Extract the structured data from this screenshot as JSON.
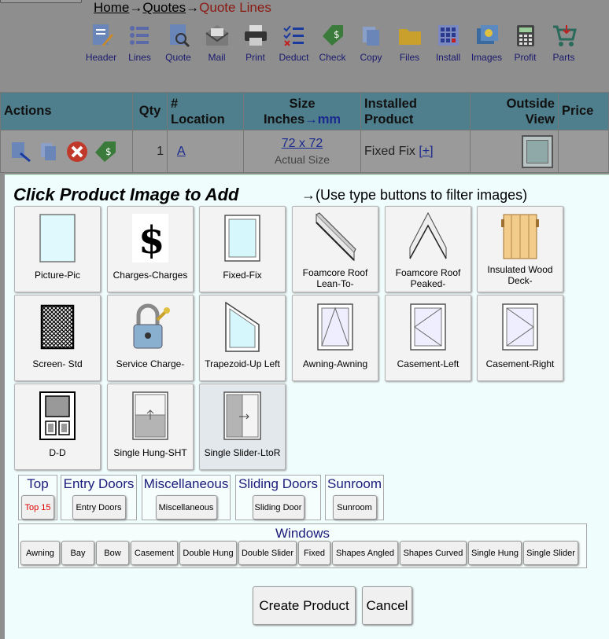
{
  "breadcrumb": {
    "home": "Home",
    "quotes": "Quotes",
    "current": "Quote Lines",
    "arrow": "→"
  },
  "toolbar": [
    {
      "label": "Header",
      "icon": "header-icon"
    },
    {
      "label": "Lines",
      "icon": "lines-icon"
    },
    {
      "label": "Quote",
      "icon": "quote-icon"
    },
    {
      "label": "Mail",
      "icon": "mail-icon"
    },
    {
      "label": "Print",
      "icon": "print-icon"
    },
    {
      "label": "Deduct",
      "icon": "deduct-icon"
    },
    {
      "label": "Check",
      "icon": "check-icon"
    },
    {
      "label": "Copy",
      "icon": "copy-icon"
    },
    {
      "label": "Files",
      "icon": "folder-icon"
    },
    {
      "label": "Install",
      "icon": "install-icon"
    },
    {
      "label": "Images",
      "icon": "images-icon"
    },
    {
      "label": "Profit",
      "icon": "calculator-icon"
    },
    {
      "label": "Parts",
      "icon": "cart-icon"
    }
  ],
  "table": {
    "headers": {
      "actions": "Actions",
      "qty": "Qty",
      "loc1": "#",
      "loc2": "Location",
      "size1": "Size",
      "size2a": "Inches",
      "size2b": "→mm",
      "prod1": "Installed",
      "prod2": "Product",
      "view1": "Outside",
      "view2": "View",
      "price": "Price"
    },
    "row": {
      "qty": "1",
      "location": "A",
      "size": "72 x 72",
      "size_note": "Actual Size",
      "product": "Fixed Fix",
      "expand": "[+]",
      "price": ""
    }
  },
  "modal": {
    "title": "Click Product Image to Add",
    "hint": "→(Use type buttons to filter images)",
    "products": [
      {
        "caption": "Picture-Pic",
        "icon": "picture-window-icon"
      },
      {
        "caption": "Charges-Charges",
        "icon": "dollar-icon"
      },
      {
        "caption": "Fixed-Fix",
        "icon": "fixed-window-icon"
      },
      {
        "caption": "Foamcore Roof Lean-To-",
        "icon": "lean-to-roof-icon"
      },
      {
        "caption": "Foamcore Roof Peaked-",
        "icon": "peaked-roof-icon"
      },
      {
        "caption": "Insulated Wood Deck-",
        "icon": "wood-deck-icon"
      },
      {
        "caption": "Screen- Std",
        "icon": "screen-icon"
      },
      {
        "caption": "Service Charge-",
        "icon": "padlock-icon"
      },
      {
        "caption": "Trapezoid-Up Left",
        "icon": "trapezoid-icon"
      },
      {
        "caption": "Awning-Awning",
        "icon": "awning-window-icon"
      },
      {
        "caption": "Casement-Left",
        "icon": "casement-left-icon"
      },
      {
        "caption": "Casement-Right",
        "icon": "casement-right-icon"
      },
      {
        "caption": "D-D",
        "icon": "door-icon"
      },
      {
        "caption": "Single Hung-SHT",
        "icon": "single-hung-icon"
      },
      {
        "caption": "Single Slider-LtoR",
        "icon": "single-slider-icon"
      }
    ],
    "groups": {
      "top": {
        "title": "Top",
        "button": "Top 15"
      },
      "entry": {
        "title": "Entry Doors",
        "button": "Entry Doors"
      },
      "misc": {
        "title": "Miscellaneous",
        "button": "Miscellaneous"
      },
      "sliding": {
        "title": "Sliding Doors",
        "button": "Sliding Door"
      },
      "sunroom": {
        "title": "Sunroom",
        "button": "Sunroom"
      },
      "windows": {
        "title": "Windows",
        "buttons": [
          "Awning",
          "Bay",
          "Bow",
          "Casement",
          "Double Hung",
          "Double Slider",
          "Fixed",
          "Shapes Angled",
          "Shapes Curved",
          "Single Hung",
          "Single Slider"
        ]
      }
    },
    "create_label": "Create Product",
    "cancel_label": "Cancel"
  },
  "colors": {
    "accent_header": "#4f7f8c",
    "modal_bg": "#f0fdfd",
    "group_title": "#1a1a7a",
    "top15_red": "#dd0000"
  }
}
